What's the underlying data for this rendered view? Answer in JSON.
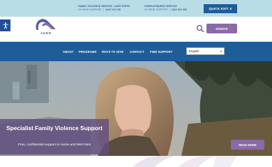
{
  "topbar": {
    "services": [
      {
        "title": "FAMILY VIOLENCE SERVICE - SAFE STEPS",
        "hours": "24 HOUR SUPPORT",
        "phone": "1800 015 188"
      },
      {
        "title": "HOMELESSNESS SERVICE",
        "hours": "24 HOUR SUPPORT",
        "phone": "1800 825 955"
      }
    ],
    "quick_exit_label": "QUICK EXIT X"
  },
  "brand": {
    "name": "JUNO",
    "accent": "#8a6aa8",
    "primary": "#1f5d99",
    "topbar_bg": "#b8dde6"
  },
  "header": {
    "donate_label": "DONATE",
    "search_icon": "search-icon"
  },
  "nav": {
    "items": [
      {
        "label": "ABOUT"
      },
      {
        "label": "PROGRAMS"
      },
      {
        "label": "WAYS TO GIVE"
      },
      {
        "label": "CONTACT"
      },
      {
        "label": "FIND SUPPORT"
      }
    ],
    "language": "English"
  },
  "hero": {
    "title": "Specialist Family Violence Support",
    "subtitle": "Free, confidential support in Hume and Merri-bek",
    "read_more_label": "READ MORE"
  }
}
